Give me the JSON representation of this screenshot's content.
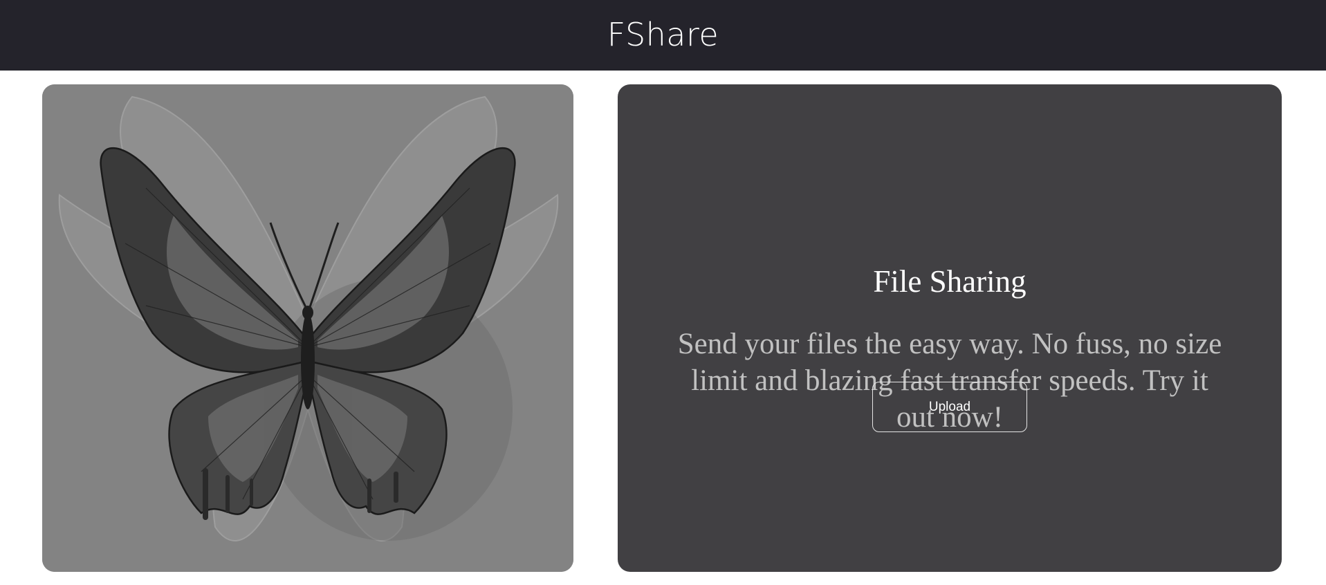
{
  "header": {
    "brand": "FShare"
  },
  "hero_image": {
    "subject": "butterfly-illustration"
  },
  "info_card": {
    "title": "File Sharing",
    "description": "Send your files the easy way. No fuss, no size limit and blazing fast transfer speeds. Try it out now!",
    "upload_label": "Upload"
  },
  "colors": {
    "header_bg": "#24232b",
    "image_card_bg": "#838383",
    "info_card_bg": "#414043",
    "title_text": "#ffffff",
    "description_text": "#c1c1c1"
  }
}
